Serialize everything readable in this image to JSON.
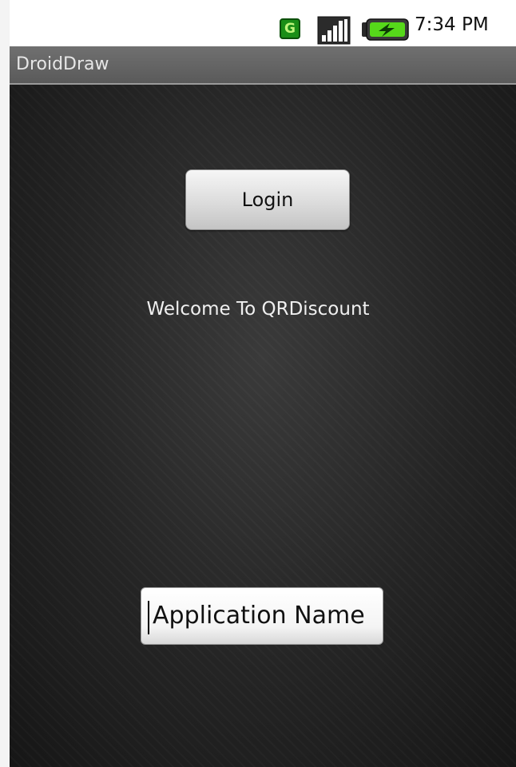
{
  "status_bar": {
    "network_badge": "G",
    "time": "7:34 PM",
    "icons": [
      "network-type-icon",
      "signal-strength-icon",
      "battery-charging-icon"
    ]
  },
  "title_bar": {
    "title": "DroidDraw"
  },
  "main": {
    "login_button_label": "Login",
    "welcome_text": "Welcome To QRDiscount",
    "app_name_input_value": "Application Name"
  },
  "colors": {
    "background": "#242424",
    "title_bar": "#5a5a5a",
    "network_badge": "#1a8e16",
    "battery_charge": "#56d81a"
  }
}
